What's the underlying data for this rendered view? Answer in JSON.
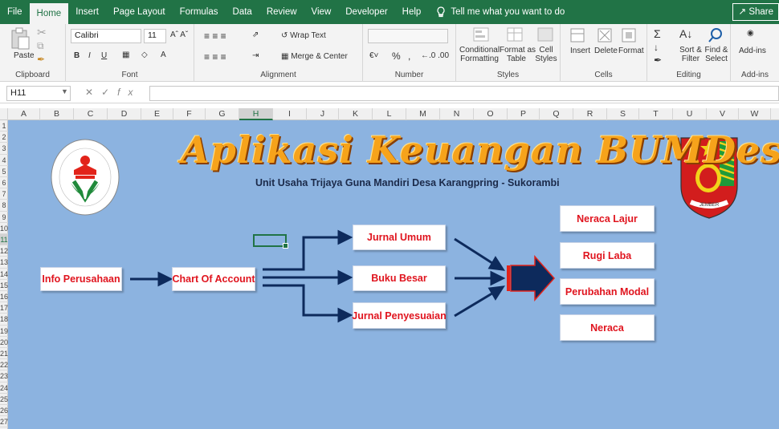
{
  "ribbon_tabs": [
    "File",
    "Home",
    "Insert",
    "Page Layout",
    "Formulas",
    "Data",
    "Review",
    "View",
    "Developer",
    "Help"
  ],
  "tell_me": "Tell me what you want to do",
  "share": "Share",
  "clipboard": {
    "paste": "Paste",
    "group": "Clipboard"
  },
  "font": {
    "name": "Calibri",
    "size": "11",
    "group": "Font",
    "bold": "B",
    "italic": "I",
    "underline": "U"
  },
  "alignment": {
    "wrap": "Wrap Text",
    "merge": "Merge & Center",
    "group": "Alignment"
  },
  "number": {
    "percent": "%",
    "comma": ",",
    "group": "Number"
  },
  "styles": {
    "conditional": "Conditional",
    "conditional2": "Formatting",
    "format_as": "Format as",
    "format_as2": "Table",
    "cell": "Cell",
    "cell2": "Styles",
    "group": "Styles"
  },
  "cells": {
    "insert": "Insert",
    "delete": "Delete",
    "format": "Format",
    "group": "Cells"
  },
  "editing": {
    "sort": "Sort &",
    "sort2": "Filter",
    "find": "Find &",
    "find2": "Select",
    "group": "Editing"
  },
  "addins": {
    "label": "Add-ins",
    "group": "Add-ins"
  },
  "formula_bar": {
    "name_box": "H11",
    "fx": "fx",
    "value": ""
  },
  "columns": [
    "A",
    "B",
    "C",
    "D",
    "E",
    "F",
    "G",
    "H",
    "I",
    "J",
    "K",
    "L",
    "M",
    "N",
    "O",
    "P",
    "Q",
    "R",
    "S",
    "T",
    "U",
    "V",
    "W"
  ],
  "rows": [
    "1",
    "2",
    "3",
    "4",
    "5",
    "6",
    "7",
    "8",
    "9",
    "10",
    "11",
    "12",
    "13",
    "14",
    "15",
    "16",
    "17",
    "18",
    "19",
    "20",
    "21",
    "22",
    "23",
    "24",
    "25",
    "26",
    "27"
  ],
  "sheet": {
    "title": "Aplikasi Keuangan BUMDes",
    "subtitle": "Unit Usaha Trijaya Guna Mandiri Desa Karangpring - Sukorambi",
    "logo_left_text": "KEMENTERIAN DESA, PEMBANGUNAN DAERAH TERTINGGAL, DAN TRANSMIGRASI",
    "logo_right_text": "JEMBER",
    "buttons": {
      "info": "Info Perusahaan",
      "coa": "Chart Of Account",
      "jurnal_umum": "Jurnal Umum",
      "buku_besar": "Buku Besar",
      "jurnal_penyesuaian": "Jurnal Penyesuaian",
      "neraca_lajur": "Neraca Lajur",
      "rugi_laba": "Rugi Laba",
      "perubahan_modal": "Perubahan Modal",
      "neraca": "Neraca"
    }
  },
  "colors": {
    "excel_green": "#217346",
    "sheet_bg": "#8cb3e0",
    "arrow": "#0d2a5c",
    "button_text": "#e0141e",
    "title": "#f6a31b"
  }
}
